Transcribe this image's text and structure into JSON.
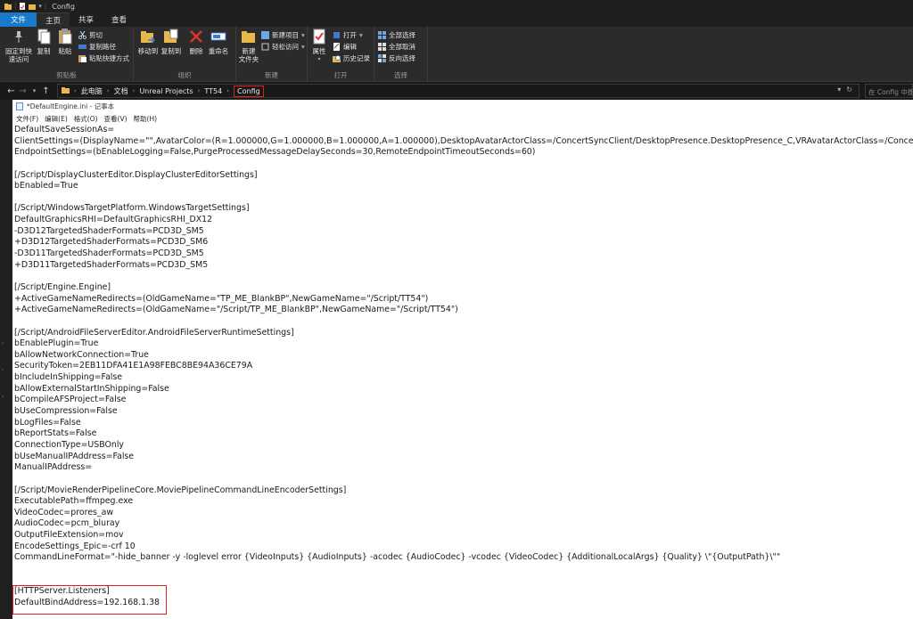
{
  "window": {
    "title": "Config"
  },
  "tabs": [
    "文件",
    "主页",
    "共享",
    "查看"
  ],
  "ribbon": {
    "clipboard": {
      "label": "剪贴板",
      "pin": "固定到快\n速访问",
      "copy": "复制",
      "paste": "粘贴",
      "cut": "剪切",
      "copy_path": "复制路径",
      "paste_shortcut": "粘贴快捷方式"
    },
    "organize": {
      "label": "组织",
      "move_to": "移动到",
      "copy_to": "复制到",
      "delete": "删除",
      "rename": "重命名"
    },
    "new": {
      "label": "新建",
      "new_folder": "新建\n文件夹",
      "new_item": "新建项目",
      "easy_access": "轻松访问"
    },
    "open": {
      "label": "打开",
      "properties": "属性",
      "open": "打开",
      "edit": "编辑",
      "history": "历史记录"
    },
    "select": {
      "label": "选择",
      "select_all": "全部选择",
      "select_none": "全部取消",
      "invert": "反向选择"
    }
  },
  "address": {
    "crumbs": [
      "此电脑",
      "文档",
      "Unreal Projects",
      "TT54",
      "Config"
    ],
    "search_placeholder": "在 Config 中搜"
  },
  "notepad": {
    "title": "*DefaultEngine.ini - 记事本",
    "menu": [
      "文件(F)",
      "编辑(E)",
      "格式(O)",
      "查看(V)",
      "帮助(H)"
    ],
    "lines": [
      "DefaultSaveSessionAs=",
      "ClientSettings=(DisplayName=\"\",AvatarColor=(R=1.000000,G=1.000000,B=1.000000,A=1.000000),DesktopAvatarActorClass=/ConcertSyncClient/DesktopPresence.DesktopPresence_C,VRAvatarActorClass=/ConcertSy",
      "EndpointSettings=(bEnableLogging=False,PurgeProcessedMessageDelaySeconds=30,RemoteEndpointTimeoutSeconds=60)",
      "",
      "[/Script/DisplayClusterEditor.DisplayClusterEditorSettings]",
      "bEnabled=True",
      "",
      "[/Script/WindowsTargetPlatform.WindowsTargetSettings]",
      "DefaultGraphicsRHI=DefaultGraphicsRHI_DX12",
      "-D3D12TargetedShaderFormats=PCD3D_SM5",
      "+D3D12TargetedShaderFormats=PCD3D_SM6",
      "-D3D11TargetedShaderFormats=PCD3D_SM5",
      "+D3D11TargetedShaderFormats=PCD3D_SM5",
      "",
      "[/Script/Engine.Engine]",
      "+ActiveGameNameRedirects=(OldGameName=\"TP_ME_BlankBP\",NewGameName=\"/Script/TT54\")",
      "+ActiveGameNameRedirects=(OldGameName=\"/Script/TP_ME_BlankBP\",NewGameName=\"/Script/TT54\")",
      "",
      "[/Script/AndroidFileServerEditor.AndroidFileServerRuntimeSettings]",
      "bEnablePlugin=True",
      "bAllowNetworkConnection=True",
      "SecurityToken=2EB11DFA41E1A98FEBC8BE94A36CE79A",
      "bIncludeInShipping=False",
      "bAllowExternalStartInShipping=False",
      "bCompileAFSProject=False",
      "bUseCompression=False",
      "bLogFiles=False",
      "bReportStats=False",
      "ConnectionType=USBOnly",
      "bUseManualIPAddress=False",
      "ManualIPAddress=",
      "",
      "[/Script/MovieRenderPipelineCore.MoviePipelineCommandLineEncoderSettings]",
      "ExecutablePath=ffmpeg.exe",
      "VideoCodec=prores_aw",
      "AudioCodec=pcm_bluray",
      "OutputFileExtension=mov",
      "EncodeSettings_Epic=-crf 10",
      "CommandLineFormat=\"-hide_banner -y -loglevel error {VideoInputs} {AudioInputs} -acodec {AudioCodec} -vcodec {VideoCodec} {AdditionalLocalArgs} {Quality} \\\"{OutputPath}\\\"\"",
      "",
      "",
      "[HTTPServer.Listeners]",
      "DefaultBindAddress=192.168.1.38"
    ]
  }
}
